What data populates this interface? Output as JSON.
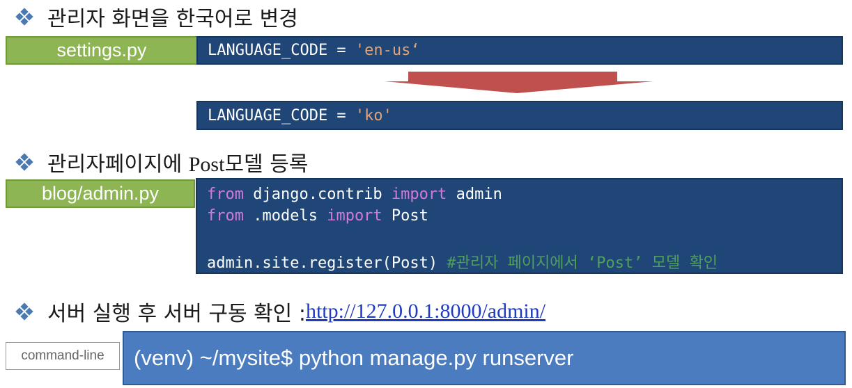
{
  "section1": {
    "heading": "관리자 화면을 한국어로 변경",
    "file_label": "settings.py",
    "before_code_prefix": "LANGUAGE_CODE = ",
    "before_code_value": "'en-us‘",
    "after_code_prefix": "LANGUAGE_CODE = ",
    "after_code_value": "'ko'"
  },
  "section2": {
    "heading_prefix": "관리자페이지에 ",
    "heading_model": "Post",
    "heading_suffix": "모델 등록",
    "file_label": "blog/admin.py",
    "code": {
      "line1_kw1": "from",
      "line1_mid": " django.contrib ",
      "line1_kw2": "import",
      "line1_end": " admin",
      "line2_kw1": "from",
      "line2_mid": " .models ",
      "line2_kw2": "import",
      "line2_end": " Post",
      "line4_code": "admin.site.register(Post) ",
      "line4_comment": "#관리자 페이지에서 ‘Post’ 모델 확인"
    }
  },
  "section3": {
    "heading": "서버 실행 후 서버 구동 확인 : ",
    "link": "http://127.0.0.1:8000/admin/",
    "cmd_label": "command-line",
    "command": "(venv) ~/mysite$ python manage.py runserver"
  },
  "icons": {
    "bullet": "diamond-bullet-icon",
    "arrow": "down-arrow-icon"
  },
  "colors": {
    "code_bg": "#1f4676",
    "label_green": "#8db554",
    "arrow_red": "#c0504d",
    "cmd_bg": "#4b7cbf"
  }
}
